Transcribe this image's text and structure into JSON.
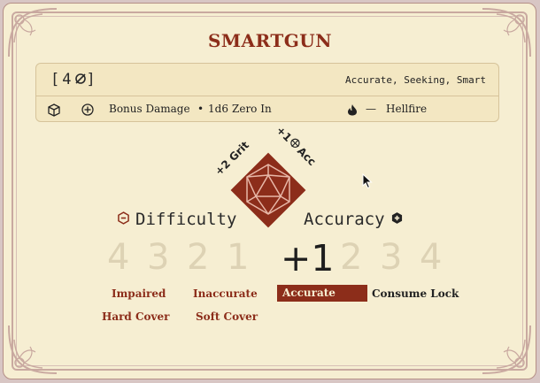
{
  "title": "SMARTGUN",
  "weapon": {
    "range_open": "[",
    "range_value": "4",
    "range_close": "]",
    "tags": "Accurate, Seeking, Smart",
    "bonus_damage_label": "Bonus Damage",
    "damage_value": "1d6",
    "zero_in": "Zero In",
    "dash": "—",
    "hellfire": "Hellfire"
  },
  "dice": {
    "grit": "+2 Grit",
    "acc_prefix": "+1",
    "acc_suffix": "Acc"
  },
  "difficulty": {
    "label": "Difficulty",
    "scale": [
      "4",
      "3",
      "2",
      "1"
    ]
  },
  "accuracy": {
    "label": "Accuracy",
    "current": "+1",
    "scale": [
      "2",
      "3",
      "4"
    ]
  },
  "modifiers": {
    "impaired": "Impaired",
    "inaccurate": "Inaccurate",
    "accurate": "Accurate",
    "consume_lock": "Consume Lock",
    "hard_cover": "Hard Cover",
    "soft_cover": "Soft Cover"
  },
  "colors": {
    "accent": "#8c2d1a",
    "paper": "#f6eed2",
    "inactive_number": "#ddd2b4"
  }
}
